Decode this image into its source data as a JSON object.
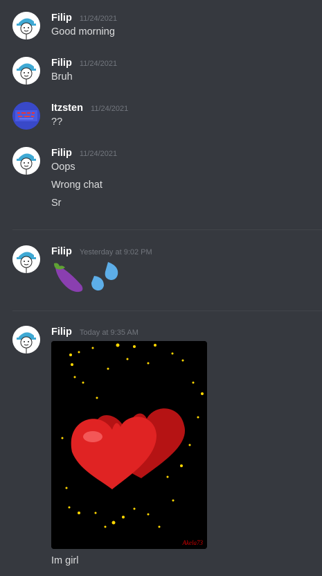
{
  "messages": [
    {
      "author": "Filip",
      "timestamp": "11/24/2021",
      "lines": [
        "Good morning"
      ]
    },
    {
      "author": "Filip",
      "timestamp": "11/24/2021",
      "lines": [
        "Bruh"
      ]
    },
    {
      "author": "Itzsten",
      "timestamp": "11/24/2021",
      "lines": [
        "??"
      ]
    },
    {
      "author": "Filip",
      "timestamp": "11/24/2021",
      "lines": [
        "Oops",
        "Wrong chat",
        "Sr"
      ]
    },
    {
      "author": "Filip",
      "timestamp": "Yesterday at 9:02 PM",
      "emojis": [
        "eggplant-emoji",
        "sweat-droplets-emoji"
      ]
    },
    {
      "author": "Filip",
      "timestamp": "Today at 9:35 AM",
      "attachment": {
        "type": "gif",
        "description": "red-hearts-gif",
        "signature": "Akela73"
      },
      "lines": [
        "Im girl"
      ]
    }
  ]
}
